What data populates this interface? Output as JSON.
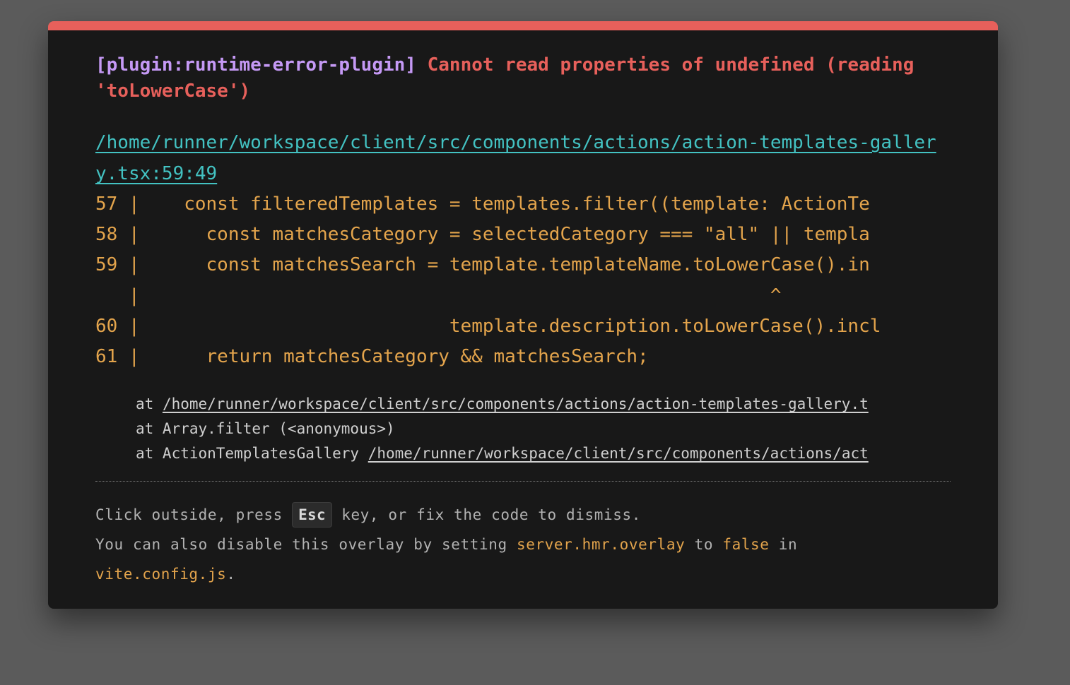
{
  "error": {
    "plugin_tag": "[plugin:runtime-error-plugin]",
    "message": "Cannot read properties of undefined (reading 'toLowerCase')"
  },
  "file": {
    "path": "/home/runner/workspace/client/src/components/actions/action-templates-gallery.tsx:59:49"
  },
  "code_frame": [
    "57 |    const filteredTemplates = templates.filter((template: ActionTe",
    "58 |      const matchesCategory = selectedCategory === \"all\" || templa",
    "59 |      const matchesSearch = template.templateName.toLowerCase().in",
    "   |                                                         ^",
    "60 |                            template.description.toLowerCase().incl",
    "61 |      return matchesCategory && matchesSearch;"
  ],
  "stack": [
    {
      "prefix": "at ",
      "location": "/home/runner/workspace/client/src/components/actions/action-templates-gallery.t"
    },
    {
      "prefix": "at Array.filter (<anonymous>)",
      "location": ""
    },
    {
      "prefix": "at ActionTemplatesGallery ",
      "location": "/home/runner/workspace/client/src/components/actions/act"
    }
  ],
  "tip": {
    "line1_before": "Click outside, press ",
    "key": "Esc",
    "line1_after": " key, or fix the code to dismiss.",
    "line2_before": "You can also disable this overlay by setting ",
    "config_key": "server.hmr.overlay",
    "line2_mid": " to ",
    "value": "false",
    "line2_after": " in",
    "config_file": "vite.config.js",
    "period": "."
  },
  "colors": {
    "accent_bar": "#e7605b",
    "plugin": "#c599f5",
    "error": "#e7605b",
    "link": "#43c2c2",
    "code": "#e3a44c",
    "background": "#181818"
  }
}
